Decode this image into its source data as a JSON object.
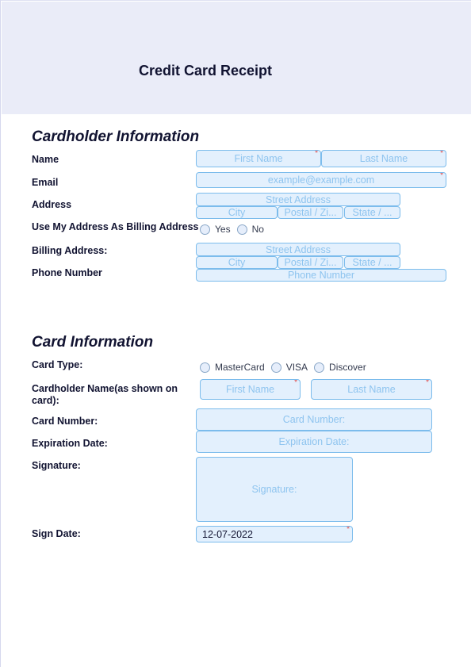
{
  "header": {
    "title": "Credit Card Receipt"
  },
  "cardholder": {
    "section_title": "Cardholder Information",
    "name_label": "Name",
    "first_name_placeholder": "First Name",
    "last_name_placeholder": "Last Name",
    "email_label": "Email",
    "email_placeholder": "example@example.com",
    "address_label": "Address",
    "street_placeholder": "Street Address",
    "city_placeholder": "City",
    "postal_placeholder": "Postal / Zi...",
    "state_placeholder": "State / ...",
    "use_billing_label": "Use My Address As Billing Address",
    "use_billing_options": [
      "Yes",
      "No"
    ],
    "billing_label": "Billing Address:",
    "billing_street_placeholder": "Street Address",
    "billing_city_placeholder": "City",
    "billing_postal_placeholder": "Postal / Zi...",
    "billing_state_placeholder": "State / ...",
    "phone_label": "Phone Number",
    "phone_placeholder": "Phone Number"
  },
  "card": {
    "section_title": "Card Information",
    "type_label": "Card Type:",
    "type_options": [
      "MasterCard",
      "VISA",
      "Discover"
    ],
    "holder_label": "Cardholder Name(as shown on card):",
    "holder_first_placeholder": "First Name",
    "holder_last_placeholder": "Last Name",
    "number_label": "Card Number:",
    "number_placeholder": "Card Number:",
    "expiration_label": "Expiration Date:",
    "expiration_placeholder": "Expiration Date:",
    "signature_label": "Signature:",
    "signature_placeholder": "Signature:",
    "sign_date_label": "Sign Date:",
    "sign_date_value": "12-07-2022"
  },
  "required_marker": "*",
  "colors": {
    "header_bg": "#eaecf8",
    "field_bg": "#e3f0fd",
    "field_border": "#7cbcec",
    "placeholder": "#8ec4ef",
    "required": "#e04a4a",
    "text": "#111331"
  }
}
